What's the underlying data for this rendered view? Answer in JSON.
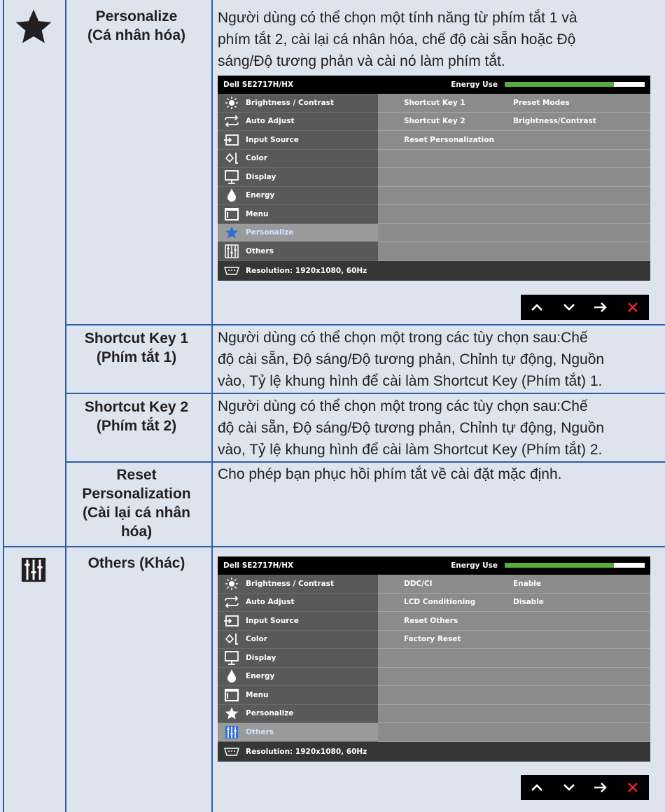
{
  "rows": {
    "personalize": {
      "name_line1": "Personalize",
      "name_line2": "(Cá nhân hóa)",
      "desc_lines": [
        "Người dùng có thể chọn một tính năng từ phím tắt 1 và",
        "phím tắt 2, cài lại cá nhân hóa, chế độ cài sẵn hoặc Độ",
        "sáng/Độ tương phản và cài nó làm phím tắt."
      ]
    },
    "shortcut1": {
      "name_line1": "Shortcut Key 1",
      "name_line2": "(Phím tắt 1)",
      "desc_lines": [
        "Người dùng có thể chọn một trong các tùy chọn sau:Chế",
        "độ cài sẵn, Độ sáng/Độ tương phản, Chỉnh tự động, Nguồn",
        "vào, Tỷ lệ khung hình để cài làm Shortcut Key (Phím tắt) 1."
      ]
    },
    "shortcut2": {
      "name_line1": "Shortcut Key 2",
      "name_line2": "(Phím tắt 2)",
      "desc_lines": [
        "Người dùng có thể chọn một trong các tùy chọn sau:Chế",
        "độ cài sẵn, Độ sáng/Độ tương phản, Chỉnh tự động, Nguồn",
        "vào, Tỷ lệ khung hình để cài làm Shortcut Key (Phím tắt) 2."
      ]
    },
    "reset": {
      "name_lines": [
        "Reset",
        "Personalization",
        "(Cài lại cá nhân",
        "hóa)"
      ],
      "desc": "Cho phép bạn phục hồi phím tắt về cài đặt mặc định."
    },
    "others": {
      "name": "Others (Khác)"
    }
  },
  "osd": {
    "model": "Dell SE2717H/HX",
    "energy_label": "Energy Use",
    "energy_level": 0.78,
    "menu": [
      "Brightness / Contrast",
      "Auto Adjust",
      "Input Source",
      "Color",
      "Display",
      "Energy",
      "Menu",
      "Personalize",
      "Others"
    ],
    "resolution": "Resolution: 1920x1080, 60Hz",
    "personalize_rows": [
      {
        "k": "Shortcut Key 1",
        "v": "Preset Modes"
      },
      {
        "k": "Shortcut Key 2",
        "v": "Brightness/Contrast"
      },
      {
        "k": "Reset Personalization",
        "v": ""
      }
    ],
    "others_rows": [
      {
        "k": "DDC/CI",
        "v": "Enable"
      },
      {
        "k": "LCD Conditioning",
        "v": "Disable"
      },
      {
        "k": "Reset Others",
        "v": ""
      },
      {
        "k": "Factory Reset",
        "v": ""
      }
    ]
  },
  "colors": {
    "accent": "#2d5fa8",
    "energy": "#57ae3a",
    "close": "#e0262d"
  }
}
